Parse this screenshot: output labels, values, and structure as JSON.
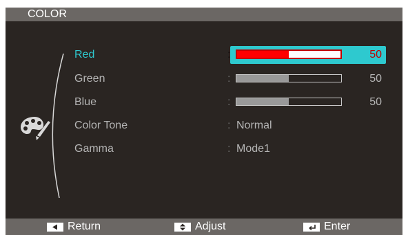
{
  "menu": {
    "title": "COLOR",
    "items": [
      {
        "label": "Red",
        "type": "slider",
        "level": 50,
        "value_text": "50",
        "selected": true
      },
      {
        "label": "Green",
        "type": "slider",
        "level": 50,
        "value_text": "50",
        "selected": false
      },
      {
        "label": "Blue",
        "type": "slider",
        "level": 50,
        "value_text": "50",
        "selected": false
      },
      {
        "label": "Color Tone",
        "type": "option",
        "value_text": "Normal",
        "selected": false
      },
      {
        "label": "Gamma",
        "type": "option",
        "value_text": "Mode1",
        "selected": false
      }
    ],
    "separator": ":"
  },
  "footer": {
    "return_label": "Return",
    "adjust_label": "Adjust",
    "enter_label": "Enter"
  },
  "icons": {
    "menu_icon": "palette-icon",
    "return_key": "left-arrow-key-icon",
    "adjust_key": "up-down-arrow-key-icon",
    "enter_key": "enter-key-icon"
  },
  "colors": {
    "accent": "#2ec9cf",
    "selected_value": "#c00000",
    "red_fill": "#ff0000",
    "bar_fill": "#999999"
  }
}
